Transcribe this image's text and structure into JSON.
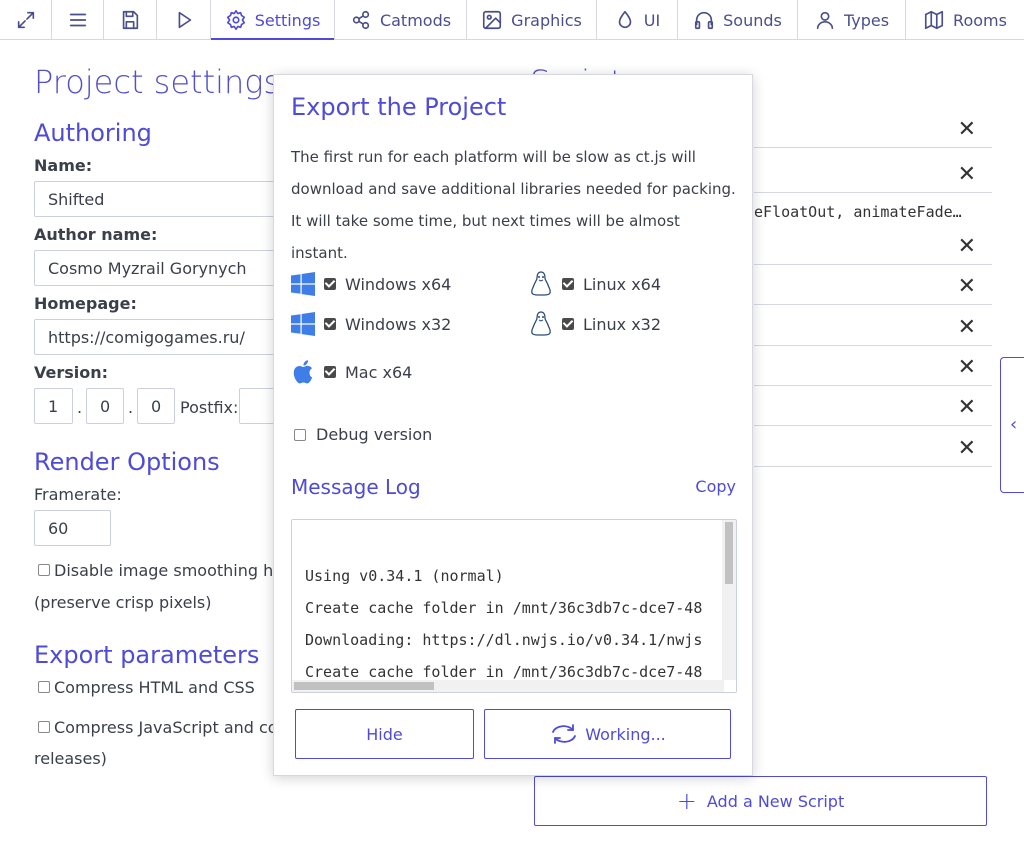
{
  "topbar": {
    "tabs": [
      {
        "icon": "maximize-icon"
      },
      {
        "icon": "menu-icon"
      },
      {
        "icon": "save-icon"
      },
      {
        "icon": "play-icon"
      },
      {
        "icon": "gear-icon",
        "label": "Settings",
        "active": true
      },
      {
        "icon": "catmods-icon",
        "label": "Catmods"
      },
      {
        "icon": "image-icon",
        "label": "Graphics"
      },
      {
        "icon": "drop-icon",
        "label": "UI"
      },
      {
        "icon": "headphones-icon",
        "label": "Sounds"
      },
      {
        "icon": "user-icon",
        "label": "Types"
      },
      {
        "icon": "map-icon",
        "label": "Rooms"
      }
    ]
  },
  "settings": {
    "title": "Project settings",
    "authoring": {
      "heading": "Authoring",
      "name_label": "Name:",
      "name_value": "Shifted",
      "author_label": "Author name:",
      "author_value": "Cosmo Myzrail Gorynych",
      "homepage_label": "Homepage:",
      "homepage_value": "https://comigogames.ru/",
      "version_label": "Version:",
      "version_major": "1",
      "version_minor": "0",
      "version_patch": "0",
      "version_sep": ".",
      "postfix_label": "Postfix:"
    },
    "render": {
      "heading": "Render Options",
      "framerate_label": "Framerate:",
      "framerate_value": "60",
      "smoothing_label": "Disable image smoothing her",
      "smoothing_label_2": "(preserve crisp pixels)"
    },
    "export": {
      "heading": "Export parameters",
      "compress_html": "Compress HTML and CSS",
      "compress_js": "Compress JavaScript and conv",
      "compress_js_2": "releases)"
    }
  },
  "scripts": {
    "title": "Scripts",
    "code_preview": "eFloatOut, animateFade…",
    "add_label": "Add a New Script"
  },
  "modal": {
    "title": "Export the Project",
    "intro": "The first run for each platform will be slow as ct.js will download and save additional libraries needed for packing. It will take some time, but next times will be almost instant.",
    "platforms": [
      {
        "icon": "windows-icon",
        "label": "Windows x64",
        "checked": true
      },
      {
        "icon": "linux-icon",
        "label": "Linux x64",
        "checked": true
      },
      {
        "icon": "windows-icon",
        "label": "Windows x32",
        "checked": true
      },
      {
        "icon": "linux-icon",
        "label": "Linux x32",
        "checked": true
      },
      {
        "icon": "apple-icon",
        "label": "Mac x64",
        "checked": true
      }
    ],
    "debug_label": "Debug version",
    "log_title": "Message Log",
    "copy_label": "Copy",
    "log_lines": [
      "Using v0.34.1 (normal)",
      "Create cache folder in /mnt/36c3db7c-dce7-48",
      "Downloading: https://dl.nwjs.io/v0.34.1/nwjs",
      "Create cache folder in /mnt/36c3db7c-dce7-48"
    ],
    "hide_label": "Hide",
    "working_label": "Working..."
  },
  "colors": {
    "accent": "#4e4bd8",
    "text": "#3a3f4a",
    "border": "#d6d8e0"
  }
}
